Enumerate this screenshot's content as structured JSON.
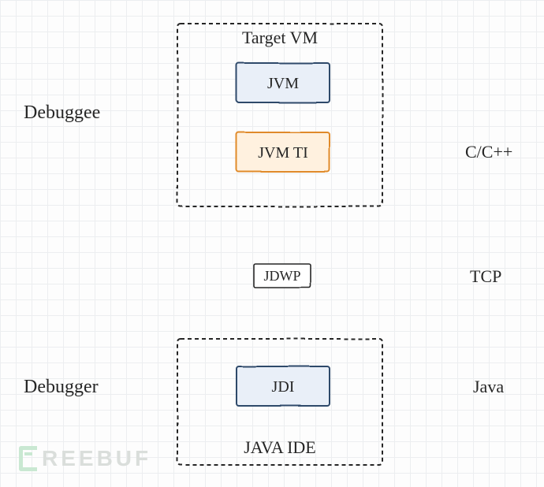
{
  "title": {
    "target_vm": "Target VM",
    "java_ide": "JAVA IDE"
  },
  "boxes": {
    "jvm": "JVM",
    "jvmti": "JVM TI",
    "jdwp": "JDWP",
    "jdi": "JDI"
  },
  "side_labels": {
    "debuggee": "Debuggee",
    "debugger": "Debugger"
  },
  "lang_labels": {
    "c_cpp": "C/C++",
    "tcp": "TCP",
    "java": "Java"
  },
  "watermark": "REEBUF",
  "colors": {
    "blue_fill": "#e9eff8",
    "blue_stroke": "#2f4a6b",
    "orange_fill": "#fff1df",
    "orange_stroke": "#e08a2a",
    "txt": "#262626",
    "dash": "#262626"
  }
}
